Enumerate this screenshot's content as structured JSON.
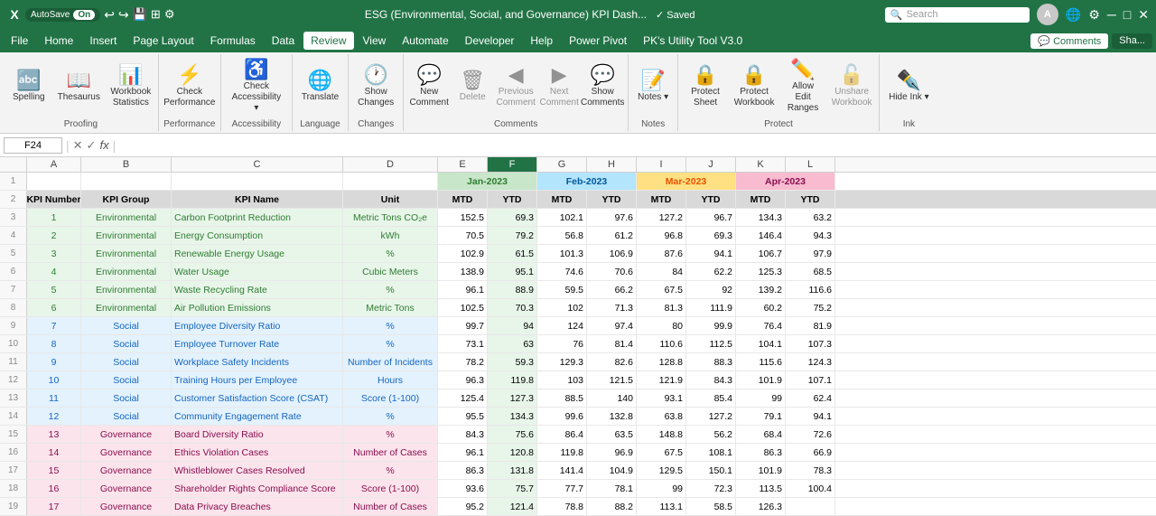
{
  "titlebar": {
    "app_icon": "X",
    "autosave_label": "AutoSave",
    "toggle_state": "On",
    "title": "ESG (Environmental, Social, and Governance) KPI Dash...",
    "saved_label": "✓ Saved",
    "search_placeholder": "Search",
    "account_initial": "A"
  },
  "menubar": {
    "items": [
      "File",
      "Home",
      "Insert",
      "Page Layout",
      "Formulas",
      "Data",
      "Review",
      "View",
      "Automate",
      "Developer",
      "Help",
      "Power Pivot",
      "PK's Utility Tool V3.0"
    ],
    "active": "Review",
    "comments_label": "Comments",
    "share_label": "Sha..."
  },
  "ribbon": {
    "groups": [
      {
        "label": "Proofing",
        "buttons": [
          {
            "icon": "🔤",
            "label": "Spelling"
          },
          {
            "icon": "📖",
            "label": "Thesaurus"
          },
          {
            "icon": "📊",
            "label": "Workbook\nStatistics"
          }
        ]
      },
      {
        "label": "Performance",
        "buttons": [
          {
            "icon": "⚡",
            "label": "Check\nPerformance"
          }
        ]
      },
      {
        "label": "Accessibility",
        "buttons": [
          {
            "icon": "♿",
            "label": "Check\nAccessibility ˅"
          }
        ]
      },
      {
        "label": "Language",
        "buttons": [
          {
            "icon": "🌐",
            "label": "Translate"
          }
        ]
      },
      {
        "label": "Changes",
        "buttons": [
          {
            "icon": "🕐",
            "label": "Show\nChanges"
          }
        ]
      },
      {
        "label": "Comments",
        "buttons": [
          {
            "icon": "💬",
            "label": "New\nComment"
          },
          {
            "icon": "🗑",
            "label": "Delete"
          },
          {
            "icon": "◀",
            "label": "Previous\nComment"
          },
          {
            "icon": "▶",
            "label": "Next\nComment"
          },
          {
            "icon": "💬",
            "label": "Show\nComments"
          }
        ]
      },
      {
        "label": "Notes",
        "buttons": [
          {
            "icon": "📝",
            "label": "Notes ˅"
          }
        ]
      },
      {
        "label": "Protect",
        "buttons": [
          {
            "icon": "🔒",
            "label": "Protect\nSheet"
          },
          {
            "icon": "🔒",
            "label": "Protect\nWorkbook"
          },
          {
            "icon": "✏",
            "label": "Allow Edit\nRanges"
          },
          {
            "icon": "🔓",
            "label": "Unshare\nWorkbook"
          }
        ]
      },
      {
        "label": "Ink",
        "buttons": [
          {
            "icon": "✒",
            "label": "Hide\nInk ˅"
          }
        ]
      }
    ]
  },
  "formulabar": {
    "namebox": "F24",
    "fx": "fx"
  },
  "columns": {
    "headers": [
      "A",
      "B",
      "C",
      "D",
      "E",
      "F",
      "G",
      "H",
      "I",
      "J",
      "K",
      "L"
    ],
    "widths": [
      60,
      100,
      200,
      100,
      60,
      60,
      60,
      60,
      60,
      60,
      60,
      60
    ],
    "selected": "F"
  },
  "month_headers": {
    "row1": [
      {
        "col": "E",
        "colspan": 2,
        "label": "Jan-2023",
        "class": "cell-span-jan"
      },
      {
        "col": "G",
        "colspan": 2,
        "label": "Feb-2023",
        "class": "cell-span-feb"
      },
      {
        "col": "I",
        "colspan": 2,
        "label": "Mar-2023",
        "class": "cell-span-mar"
      },
      {
        "col": "K",
        "colspan": 2,
        "label": "Apr-2023",
        "class": "cell-span-apr"
      }
    ]
  },
  "col_labels": [
    "KPI Number",
    "KPI Group",
    "KPI Name",
    "Unit",
    "MTD",
    "YTD",
    "MTD",
    "YTD",
    "MTD",
    "YTD",
    "MTD",
    "YTD"
  ],
  "rows": [
    {
      "num": 3,
      "kpi": 1,
      "group": "Environmental",
      "name": "Carbon Footprint Reduction",
      "unit": "Metric Tons CO₂e",
      "e52": 152.5,
      "f53": 69.3,
      "g54": 102.1,
      "h55": 97.6,
      "i56": 127.2,
      "j57": 96.7,
      "k58": 134.3,
      "l59": 63.2
    },
    {
      "num": 4,
      "kpi": 2,
      "group": "Environmental",
      "name": "Energy Consumption",
      "unit": "kWh",
      "e52": 70.5,
      "f53": 79.2,
      "g54": 56.8,
      "h55": 61.2,
      "i56": 96.8,
      "j57": 69.3,
      "k58": 146.4,
      "l59": 94.3
    },
    {
      "num": 5,
      "kpi": 3,
      "group": "Environmental",
      "name": "Renewable Energy Usage",
      "unit": "%",
      "e52": 102.9,
      "f53": 61.5,
      "g54": 101.3,
      "h55": 106.9,
      "i56": 87.6,
      "j57": 94.1,
      "k58": 106.7,
      "l59": 97.9
    },
    {
      "num": 6,
      "kpi": 4,
      "group": "Environmental",
      "name": "Water Usage",
      "unit": "Cubic Meters",
      "e52": 138.9,
      "f53": 95.1,
      "g54": 74.6,
      "h55": 70.6,
      "i56": 84.0,
      "j57": 62.2,
      "k58": 125.3,
      "l59": 68.5
    },
    {
      "num": 7,
      "kpi": 5,
      "group": "Environmental",
      "name": "Waste Recycling Rate",
      "unit": "%",
      "e52": 96.1,
      "f53": 88.9,
      "g54": 59.5,
      "h55": 66.2,
      "i56": 67.5,
      "j57": 92.0,
      "k58": 139.2,
      "l59": 116.6
    },
    {
      "num": 8,
      "kpi": 6,
      "group": "Environmental",
      "name": "Air Pollution Emissions",
      "unit": "Metric Tons",
      "e52": 102.5,
      "f53": 70.3,
      "g54": 102.0,
      "h55": 71.3,
      "i56": 81.3,
      "j57": 111.9,
      "k58": 60.2,
      "l59": 75.2
    },
    {
      "num": 9,
      "kpi": 7,
      "group": "Social",
      "name": "Employee Diversity Ratio",
      "unit": "%",
      "e52": 99.7,
      "f53": 94.0,
      "g54": 124.0,
      "h55": 97.4,
      "i56": 80.0,
      "j57": 99.9,
      "k58": 76.4,
      "l59": 81.9
    },
    {
      "num": 10,
      "kpi": 8,
      "group": "Social",
      "name": "Employee Turnover Rate",
      "unit": "%",
      "e52": 73.1,
      "f53": 63.0,
      "g54": 76.0,
      "h55": 81.4,
      "i56": 110.6,
      "j57": 112.5,
      "k58": 104.1,
      "l59": 107.3
    },
    {
      "num": 11,
      "kpi": 9,
      "group": "Social",
      "name": "Workplace Safety Incidents",
      "unit": "Number of Incidents",
      "e52": 78.2,
      "f53": 59.3,
      "g54": 129.3,
      "h55": 82.6,
      "i56": 128.8,
      "j57": 88.3,
      "k58": 115.6,
      "l59": 124.3
    },
    {
      "num": 12,
      "kpi": 10,
      "group": "Social",
      "name": "Training Hours per Employee",
      "unit": "Hours",
      "e52": 96.3,
      "f53": 119.8,
      "g54": 103.0,
      "h55": 121.5,
      "i56": 121.9,
      "j57": 84.3,
      "k58": 101.9,
      "l59": 107.1
    },
    {
      "num": 13,
      "kpi": 11,
      "group": "Social",
      "name": "Customer Satisfaction Score (CSAT)",
      "unit": "Score (1-100)",
      "e52": 125.4,
      "f53": 127.3,
      "g54": 88.5,
      "h55": 140.0,
      "i56": 93.1,
      "j57": 85.4,
      "k58": 99.0,
      "l59": 62.4
    },
    {
      "num": 14,
      "kpi": 12,
      "group": "Social",
      "name": "Community Engagement Rate",
      "unit": "%",
      "e52": 95.5,
      "f53": 134.3,
      "g54": 99.6,
      "h55": 132.8,
      "i56": 63.8,
      "j57": 127.2,
      "k58": 79.1,
      "l59": 94.1
    },
    {
      "num": 15,
      "kpi": 13,
      "group": "Governance",
      "name": "Board Diversity Ratio",
      "unit": "%",
      "e52": 84.3,
      "f53": 75.6,
      "g54": 86.4,
      "h55": 63.5,
      "i56": 148.8,
      "j57": 56.2,
      "k58": 68.4,
      "l59": 72.6
    },
    {
      "num": 16,
      "kpi": 14,
      "group": "Governance",
      "name": "Ethics Violation Cases",
      "unit": "Number of Cases",
      "e52": 96.1,
      "f53": 120.8,
      "g54": 119.8,
      "h55": 96.9,
      "i56": 67.5,
      "j57": 108.1,
      "k58": 86.3,
      "l59": 66.9
    },
    {
      "num": 17,
      "kpi": 15,
      "group": "Governance",
      "name": "Whistleblower Cases Resolved",
      "unit": "%",
      "e52": 86.3,
      "f53": 131.8,
      "g54": 141.4,
      "h55": 104.9,
      "i56": 129.5,
      "j57": 150.1,
      "k58": 101.9,
      "l59": 78.3
    },
    {
      "num": 18,
      "kpi": 16,
      "group": "Governance",
      "name": "Shareholder Rights Compliance Score",
      "unit": "Score (1-100)",
      "e52": 93.6,
      "f53": 75.7,
      "g54": 77.7,
      "h55": 78.1,
      "i56": 99.0,
      "j57": 72.3,
      "k58": 113.5,
      "l59": 100.4
    },
    {
      "num": 19,
      "kpi": 17,
      "group": "Governance",
      "name": "Data Privacy Breaches",
      "unit": "Number of Cases",
      "e52": 95.2,
      "f53": 121.4,
      "g54": 78.8,
      "h55": 88.2,
      "i56": 113.1,
      "j57": 58.5,
      "k58": 126.3,
      "l59": ""
    }
  ],
  "colors": {
    "excel_green": "#217346",
    "env_bg": "#e8f5e9",
    "env_text": "#2e7d32",
    "soc_bg": "#e3f2fd",
    "soc_text": "#1565c0",
    "gov_bg": "#fce4ec",
    "gov_text": "#880e4f",
    "selected_col": "#e8f5e9"
  }
}
